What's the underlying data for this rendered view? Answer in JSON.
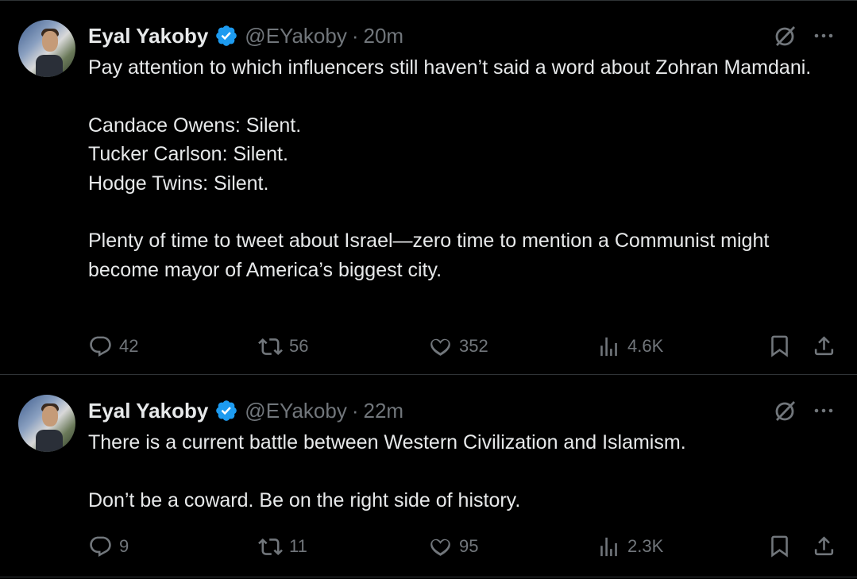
{
  "tweets": [
    {
      "author_name": "Eyal Yakoby",
      "handle": "@EYakoby",
      "dot": "·",
      "time": "20m",
      "text": "Pay attention to which influencers still haven’t said a word about Zohran Mamdani.\n\nCandace Owens: Silent.\nTucker Carlson: Silent.\nHodge Twins: Silent.\n\nPlenty of time to tweet about Israel—zero time to mention a Communist might become mayor of America’s biggest city.",
      "replies": "42",
      "reposts": "56",
      "likes": "352",
      "views": "4.6K"
    },
    {
      "author_name": "Eyal Yakoby",
      "handle": "@EYakoby",
      "dot": "·",
      "time": "22m",
      "text": "There is a current battle between Western Civilization and Islamism.\n\nDon’t be a coward. Be on the right side of history.",
      "replies": "9",
      "reposts": "11",
      "likes": "95",
      "views": "2.3K"
    }
  ],
  "colors": {
    "background": "#000000",
    "text": "#e7e9ea",
    "secondary": "#71767b",
    "verified": "#1d9bf0",
    "divider": "#2f3336"
  },
  "icons": [
    "avatar",
    "verified-badge-icon",
    "grok-icon",
    "more-icon",
    "reply-icon",
    "repost-icon",
    "like-icon",
    "views-icon",
    "bookmark-icon",
    "share-icon"
  ]
}
